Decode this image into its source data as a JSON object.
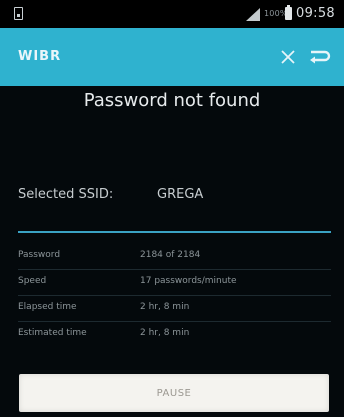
{
  "status_bar": {
    "battery_percent": "100%",
    "time": "09:58"
  },
  "action_bar": {
    "title": "WIBR"
  },
  "main": {
    "status_heading": "Password not found",
    "ssid_label": "Selected SSID:",
    "ssid_value": "GREGA",
    "stats": [
      {
        "label": "Password",
        "value": "2184 of 2184"
      },
      {
        "label": "Speed",
        "value": "17 passwords/minute"
      },
      {
        "label": "Elapsed time",
        "value": "2 hr, 8 min"
      },
      {
        "label": "Estimated time",
        "value": "2 hr, 8 min"
      }
    ],
    "pause_label": "PAUSE"
  },
  "colors": {
    "accent": "#2fb2cf",
    "background": "#04090c",
    "divider": "#3aa2c3",
    "button_bg": "#f4f3ef"
  },
  "icons": [
    "sim-card-icon",
    "signal-icon",
    "battery-icon",
    "close-icon",
    "back-icon"
  ]
}
